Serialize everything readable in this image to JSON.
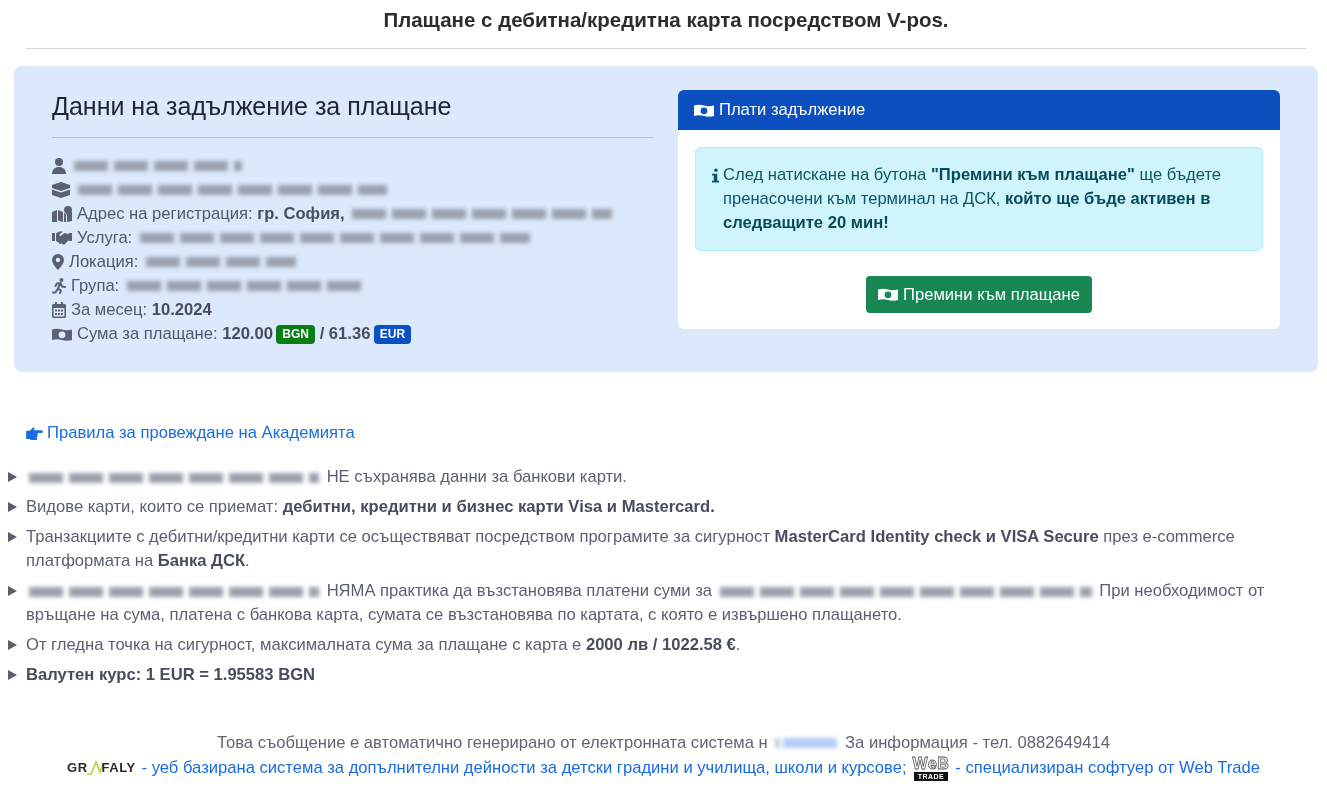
{
  "page_title": "Плащане с дебитна/кредитна карта посредством V-pos.",
  "debt_panel": {
    "heading": "Данни на задължение за плащане",
    "details": [
      {
        "kind": "client",
        "parts": [
          {
            "kind": "redacted"
          }
        ]
      },
      {
        "kind": "organization",
        "parts": [
          {
            "kind": "redacted"
          }
        ]
      },
      {
        "kind": "address",
        "parts": [
          {
            "kind": "text",
            "text": "Адрес на регистрация: **гр. София,**"
          },
          {
            "kind": "redacted"
          }
        ]
      },
      {
        "kind": "service",
        "parts": [
          {
            "kind": "text",
            "text": "Услуга:"
          },
          {
            "kind": "redacted"
          }
        ]
      },
      {
        "kind": "location",
        "parts": [
          {
            "kind": "text",
            "text": "Локация:"
          },
          {
            "kind": "redacted"
          }
        ]
      },
      {
        "kind": "group",
        "parts": [
          {
            "kind": "text",
            "text": "Група:"
          },
          {
            "kind": "redacted"
          }
        ]
      },
      {
        "kind": "month",
        "parts": [
          {
            "kind": "text",
            "text": "За месец: **10.2024**"
          }
        ]
      },
      {
        "kind": "amount",
        "parts": [
          {
            "kind": "text",
            "text": "Сума за плащане: **120.00**"
          },
          {
            "kind": "badge",
            "text": "BGN",
            "color": "#0a7d14"
          },
          {
            "kind": "strong",
            "text": "/ 61.36"
          },
          {
            "kind": "badge",
            "text": "EUR",
            "color": "#0b50c0"
          }
        ]
      }
    ]
  },
  "payment_card": {
    "header": "Плати задължение",
    "notice": "След натискане на бутона **\"Премини към плащане\"** ще бъдете пренасочени към терминал на ДСК, **който ще бъде активен в следващите 20 мин!**",
    "button": "Премини към плащане"
  },
  "rules_link": "Правила за провеждане на Академията",
  "rules": [
    {
      "parts": [
        {
          "kind": "redacted"
        },
        {
          "kind": "text",
          "text": "НЕ съхранява данни за банкови карти."
        }
      ]
    },
    {
      "parts": [
        {
          "kind": "text",
          "text": "Видове карти, които се приемат: **дебитни, кредитни и бизнес карти Visa и Mastercard.**"
        }
      ]
    },
    {
      "parts": [
        {
          "kind": "text",
          "text": "Транзакциите с дебитни/кредитни карти се осъществяват посредством програмите за сигурност **MasterCard Identity check и VISA Secure** през e-commerce платформата на **Банка ДСК**."
        }
      ]
    },
    {
      "parts": [
        {
          "kind": "redacted"
        },
        {
          "kind": "text",
          "text": "НЯМА практика да възстановява платени суми за"
        },
        {
          "kind": "redacted"
        },
        {
          "kind": "text",
          "text": "При необходимост от връщане на сума, платена с банкова карта, сумата се възстановява по картата, с която е извършено плащането."
        }
      ]
    },
    {
      "parts": [
        {
          "kind": "text",
          "text": "От гледна точка на сигурност, максималната сума за плащане с карта е **2000 лв / 1022.58 €**."
        }
      ]
    },
    {
      "parts": [
        {
          "kind": "strong",
          "text": "Валутен курс: 1 EUR = 1.95583 BGN"
        }
      ]
    }
  ],
  "footer": {
    "notice_parts": [
      {
        "kind": "text",
        "text": "Това съобщение е автоматично генерирано от електронната система н"
      },
      {
        "kind": "redacted"
      },
      {
        "kind": "text",
        "text": "За информация - тел. 0882649414"
      }
    ],
    "grafaly_logo": {
      "left": "GR",
      "right": "FALY"
    },
    "grafaly_link": "- уеб базирана система за допълнителни дейности за детски градини и училища, школи и курсове;",
    "webtrade_logo": {
      "top": "WeB",
      "bottom": "TRADE"
    },
    "webtrade_link": "- специализиран софтуер от Web Trade"
  }
}
